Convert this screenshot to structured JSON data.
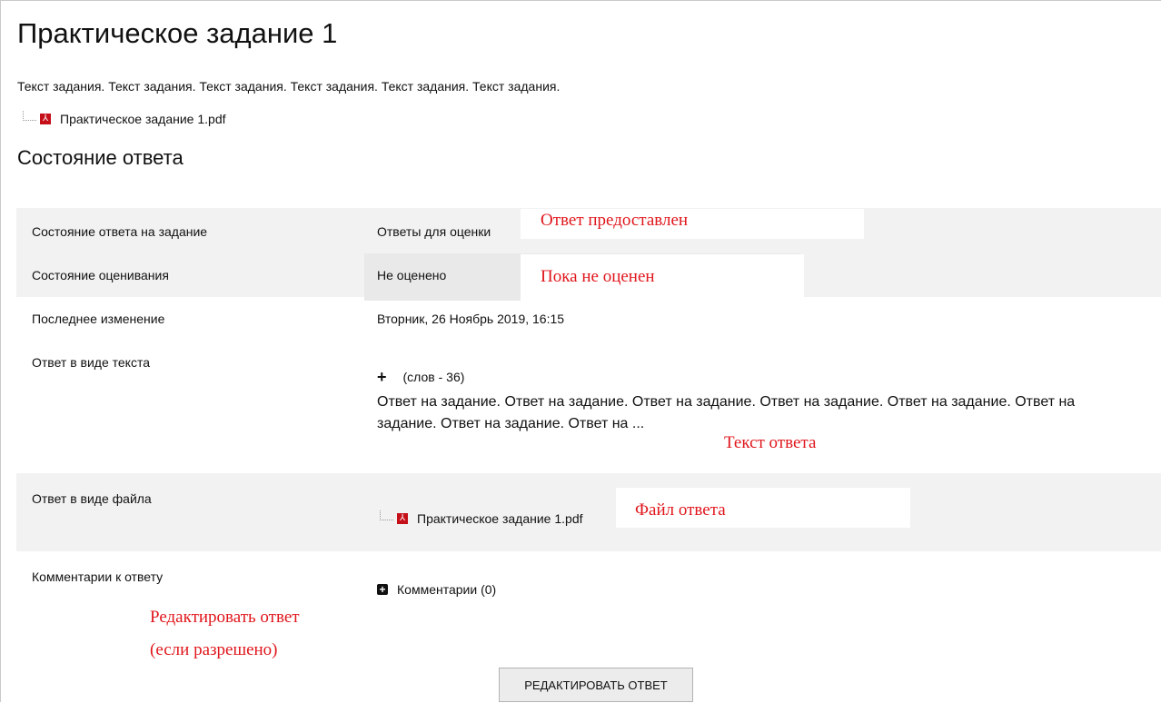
{
  "page": {
    "title": "Практическое задание 1",
    "description": "Текст задания. Текст задания. Текст задания. Текст задания. Текст задания. Текст задания.",
    "attachment": {
      "name": "Практическое задание 1.pdf",
      "icon": "pdf-icon"
    }
  },
  "status": {
    "heading": "Состояние ответа",
    "rows": {
      "submission_status": {
        "label": "Состояние ответа на задание",
        "value": "Ответы для оценки"
      },
      "grading_status": {
        "label": "Состояние оценивания",
        "value": "Не оценено"
      },
      "last_modified": {
        "label": "Последнее изменение",
        "value": "Вторник, 26 Ноябрь 2019, 16:15"
      },
      "online_text": {
        "label": "Ответ в виде текста",
        "word_count": "(слов - 36)",
        "text_line1": "Ответ на задание. Ответ на задание. Ответ на задание. Ответ на задание. Ответ на задание. Ответ на",
        "text_line2": "задание. Ответ на задание. Ответ на ..."
      },
      "file_submission": {
        "label": "Ответ в виде файла",
        "file_name": "Практическое задание 1.pdf"
      },
      "comments": {
        "label": "Комментарии к ответу",
        "link": "Комментарии (0)"
      }
    },
    "edit_button": "РЕДАКТИРОВАТЬ ОТВЕТ"
  },
  "annotations": {
    "submitted": "Ответ предоставлен",
    "not_graded": "Пока не оценен",
    "answer_text": "Текст ответа",
    "answer_file": "Файл ответа",
    "edit_line1": "Редактировать ответ",
    "edit_line2": "(если разрешено)"
  },
  "colors": {
    "annotation": "#e0161c",
    "pdf": "#c5101a",
    "row_shade": "#f2f2f2"
  }
}
